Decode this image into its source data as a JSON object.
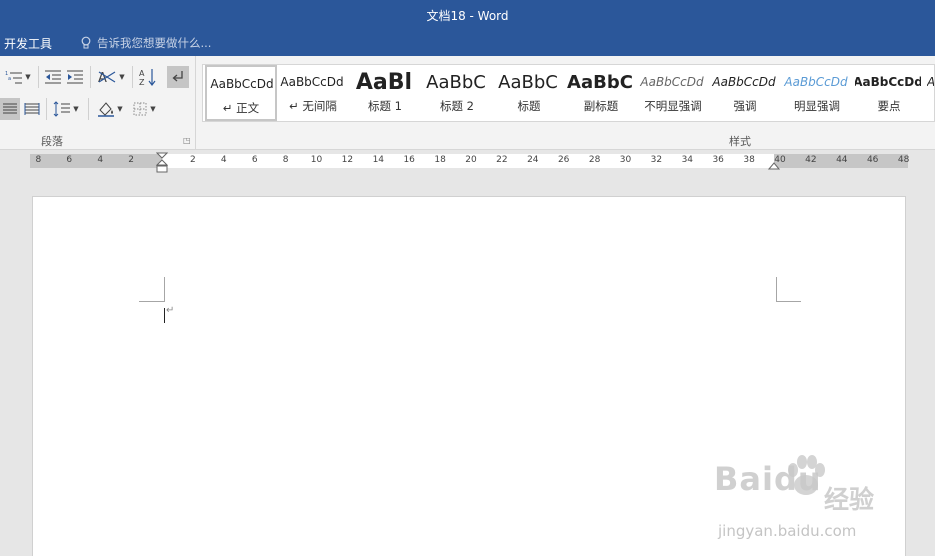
{
  "window": {
    "title": "文档18 - Word"
  },
  "ribbon_tabs": {
    "active_tab": "开发工具"
  },
  "tell_me": {
    "text": "告诉我您想要做什么...",
    "icon": "lightbulb-icon"
  },
  "paragraph_group": {
    "label": "段落",
    "buttons": [
      "multilevel-list-icon",
      "decrease-indent-icon",
      "increase-indent-icon",
      "chinese-layout-icon",
      "sort-icon",
      "show-formatting-marks-icon",
      "justify-icon",
      "distributed-icon",
      "line-spacing-icon",
      "shading-icon",
      "borders-icon"
    ]
  },
  "styles_group": {
    "label": "样式",
    "items": [
      {
        "preview": "AaBbCcDd",
        "name": "↵ 正文"
      },
      {
        "preview": "AaBbCcDd",
        "name": "↵ 无间隔"
      },
      {
        "preview": "AaBl",
        "name": "标题 1"
      },
      {
        "preview": "AaBbC",
        "name": "标题 2"
      },
      {
        "preview": "AaBbC",
        "name": "标题"
      },
      {
        "preview": "AaBbC",
        "name": "副标题"
      },
      {
        "preview": "AaBbCcDd",
        "name": "不明显强调"
      },
      {
        "preview": "AaBbCcDd",
        "name": "强调"
      },
      {
        "preview": "AaBbCcDd",
        "name": "明显强调"
      },
      {
        "preview": "AaBbCcDd",
        "name": "要点"
      },
      {
        "preview": "A",
        "name": ""
      }
    ],
    "selected_index": 0
  },
  "ruler": {
    "left_labels": [
      "8",
      "6",
      "4",
      "2"
    ],
    "right_labels": [
      "2",
      "4",
      "6",
      "8",
      "10",
      "12",
      "14",
      "16",
      "18",
      "20",
      "22",
      "24",
      "26",
      "28",
      "30",
      "32",
      "34",
      "36",
      "38",
      "40",
      "42",
      "44",
      "46",
      "48"
    ]
  },
  "document": {
    "paragraph_mark": "↵"
  },
  "watermark": {
    "brand": "Baidu",
    "brand_cn": "经验",
    "url": "jingyan.baidu.com"
  },
  "colors": {
    "title_bar": "#2b579a",
    "ribbon": "#f3f3f3",
    "workspace": "#e6e6e6"
  }
}
